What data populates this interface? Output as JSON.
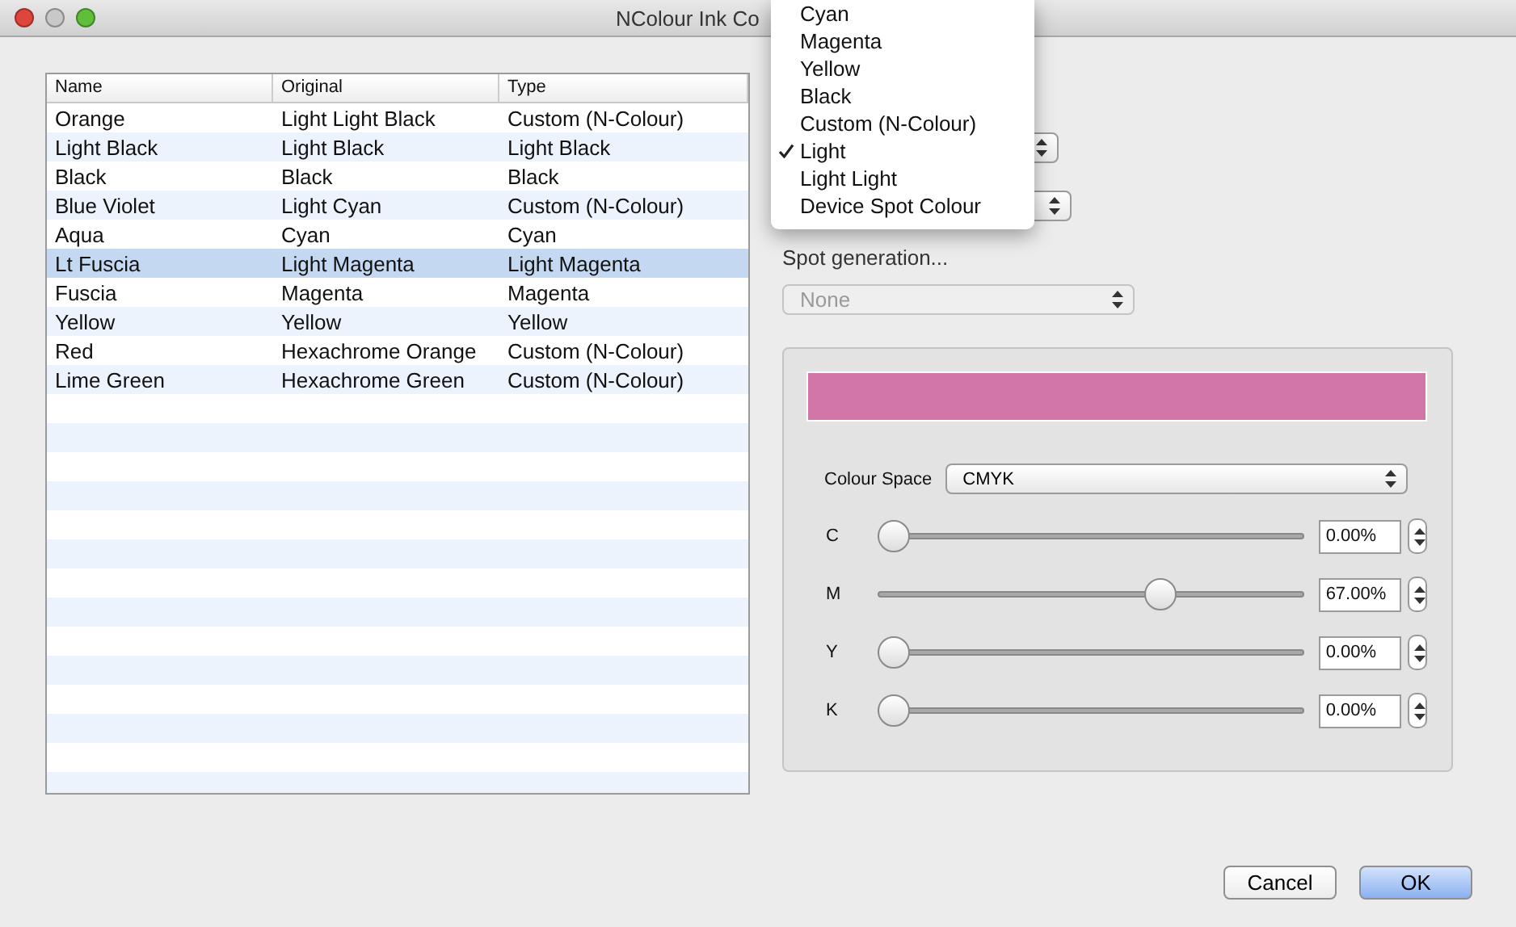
{
  "window": {
    "title": "NColour Ink Co"
  },
  "table": {
    "columns": [
      "Name",
      "Original",
      "Type"
    ],
    "rows": [
      {
        "cells": [
          "Orange",
          "Light Light Black",
          "Custom (N-Colour)"
        ],
        "selected": false
      },
      {
        "cells": [
          "Light Black",
          "Light Black",
          "Light Black"
        ],
        "selected": false
      },
      {
        "cells": [
          "Black",
          "Black",
          "Black"
        ],
        "selected": false
      },
      {
        "cells": [
          "Blue Violet",
          "Light Cyan",
          "Custom (N-Colour)"
        ],
        "selected": false
      },
      {
        "cells": [
          "Aqua",
          "Cyan",
          "Cyan"
        ],
        "selected": false
      },
      {
        "cells": [
          "Lt Fuscia",
          "Light Magenta",
          "Light Magenta"
        ],
        "selected": true
      },
      {
        "cells": [
          "Fuscia",
          "Magenta",
          "Magenta"
        ],
        "selected": false
      },
      {
        "cells": [
          "Yellow",
          "Yellow",
          "Yellow"
        ],
        "selected": false
      },
      {
        "cells": [
          "Red",
          "Hexachrome Orange",
          "Custom (N-Colour)"
        ],
        "selected": false
      },
      {
        "cells": [
          "Lime Green",
          "Hexachrome Green",
          "Custom (N-Colour)"
        ],
        "selected": false
      }
    ]
  },
  "menu": [
    {
      "label": "Cyan",
      "checked": false
    },
    {
      "label": "Magenta",
      "checked": false
    },
    {
      "label": "Yellow",
      "checked": false
    },
    {
      "label": "Black",
      "checked": false
    },
    {
      "label": "Custom (N-Colour)",
      "checked": false
    },
    {
      "label": "Light",
      "checked": true
    },
    {
      "label": "Light Light",
      "checked": false
    },
    {
      "label": "Device Spot Colour",
      "checked": false
    }
  ],
  "spot_generation": {
    "label": "Spot generation...",
    "value": "None",
    "disabled": true
  },
  "colour": {
    "color": "#d276aa",
    "space_label": "Colour Space",
    "space": "CMYK",
    "channels": [
      {
        "name": "C",
        "level": 0,
        "reading": "0.00%"
      },
      {
        "name": "M",
        "level": 0.67,
        "reading": "67.00%"
      },
      {
        "name": "Y",
        "level": 0,
        "reading": "0.00%"
      },
      {
        "name": "K",
        "level": 0,
        "reading": "0.00%"
      }
    ]
  },
  "buttons": [
    {
      "label": "Cancel",
      "default": false
    },
    {
      "label": "OK",
      "default": true
    }
  ]
}
